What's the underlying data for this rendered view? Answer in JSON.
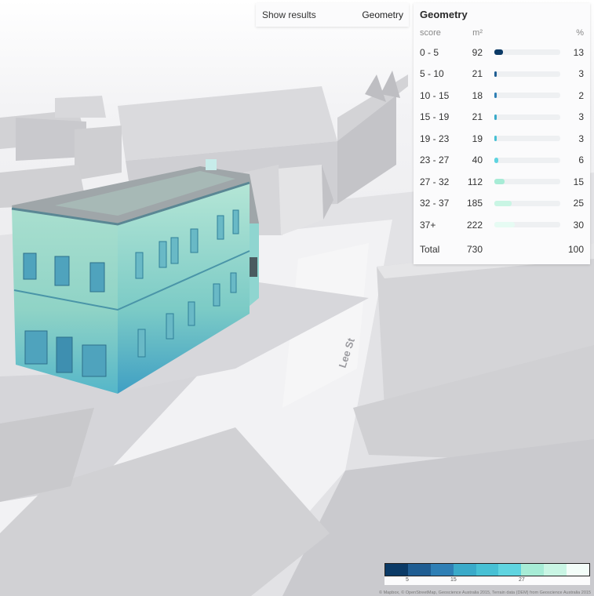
{
  "toolbar": {
    "show_results_label": "Show results",
    "mode_label": "Geometry"
  },
  "panel": {
    "title": "Geometry",
    "headers": {
      "score": "score",
      "area": "m²",
      "pct": "%"
    },
    "rows": [
      {
        "score": "0 - 5",
        "area": "92",
        "pct": "13",
        "share": 0.13,
        "color": "#0b3a66"
      },
      {
        "score": "5 - 10",
        "area": "21",
        "pct": "3",
        "share": 0.03,
        "color": "#1f5d92"
      },
      {
        "score": "10 - 15",
        "area": "18",
        "pct": "2",
        "share": 0.02,
        "color": "#2f7fb5"
      },
      {
        "score": "15 - 19",
        "area": "21",
        "pct": "3",
        "share": 0.03,
        "color": "#3aaac9"
      },
      {
        "score": "19 - 23",
        "area": "19",
        "pct": "3",
        "share": 0.03,
        "color": "#47c0d4"
      },
      {
        "score": "23 - 27",
        "area": "40",
        "pct": "6",
        "share": 0.06,
        "color": "#5fd4e0"
      },
      {
        "score": "27 - 32",
        "area": "112",
        "pct": "15",
        "share": 0.15,
        "color": "#a7ecd6"
      },
      {
        "score": "32 - 37",
        "area": "185",
        "pct": "25",
        "share": 0.25,
        "color": "#c9f5e4"
      },
      {
        "score": "37+",
        "area": "222",
        "pct": "30",
        "share": 0.3,
        "color": "#e6fbf3"
      }
    ],
    "total": {
      "label": "Total",
      "area": "730",
      "pct": "100"
    }
  },
  "map": {
    "street_label": "Lee St"
  },
  "legend": {
    "colors": [
      "#0b3a66",
      "#1f5d92",
      "#2f7fb5",
      "#3aaac9",
      "#47c0d4",
      "#5fd4e0",
      "#a7ecd6",
      "#c9f5e4",
      "#f3fdf9"
    ],
    "ticks": [
      "5",
      "15",
      "27"
    ],
    "attribution": "© Mapbox, © OpenStreetMap, Geoscience Australia 2015, Terrain data (DEM) from Geoscience Australia 2015"
  }
}
